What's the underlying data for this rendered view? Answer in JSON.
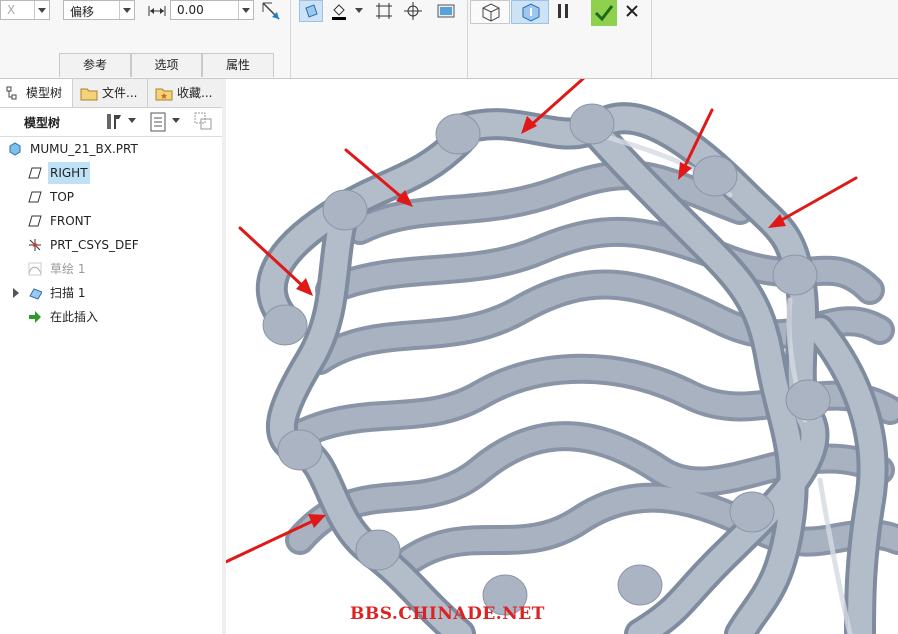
{
  "ribbon": {
    "mode_value": "X",
    "offset_select": "偏移",
    "dimension_value": "0.00",
    "subtabs": [
      "参考",
      "选项",
      "属性"
    ],
    "colors": {
      "confirm": "#8fd14f",
      "toggle_active": "#cde3f5"
    }
  },
  "left_panel": {
    "tabs": [
      "模型树",
      "文件...",
      "收藏..."
    ],
    "toolbar_label": "模型树",
    "tree": {
      "root": "MUMU_21_BX.PRT",
      "items": [
        {
          "label": "RIGHT",
          "icon": "datum-plane-icon",
          "selected": true
        },
        {
          "label": "TOP",
          "icon": "datum-plane-icon"
        },
        {
          "label": "FRONT",
          "icon": "datum-plane-icon"
        },
        {
          "label": "PRT_CSYS_DEF",
          "icon": "csys-icon"
        },
        {
          "label": "草绘 1",
          "icon": "sketch-icon",
          "dimmed": true
        },
        {
          "label": "扫描 1",
          "icon": "sweep-icon",
          "expandable": true
        },
        {
          "label": "在此插入",
          "icon": "insert-arrow-icon"
        }
      ]
    }
  },
  "viewport": {
    "watermark": "BBS.CHINADE.NET",
    "colors": {
      "tube": "#9aa5b6",
      "tube_light": "#cfd6df",
      "arrow": "#e01818"
    }
  }
}
